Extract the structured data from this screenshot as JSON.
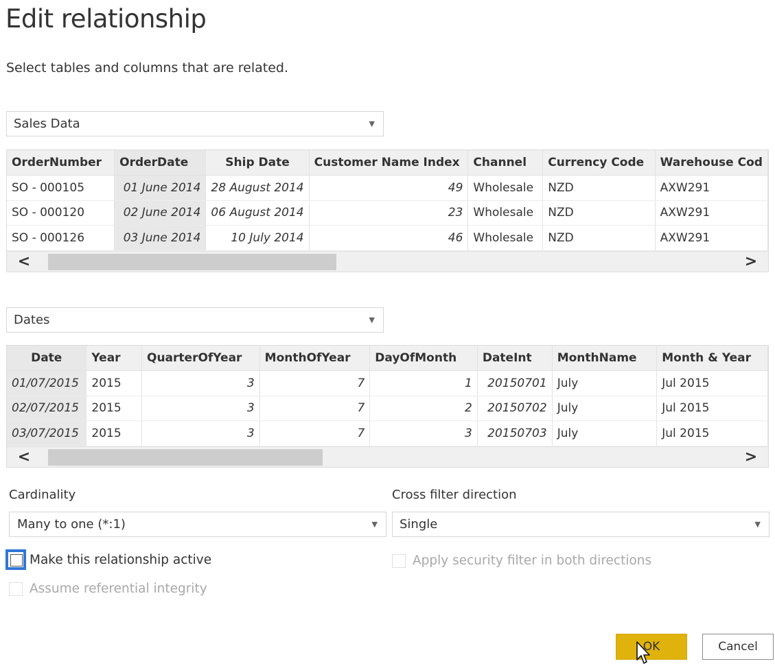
{
  "dialog": {
    "title": "Edit relationship",
    "subtitle": "Select tables and columns that are related."
  },
  "table1": {
    "selected_table": "Sales Data",
    "columns": [
      "OrderNumber",
      "OrderDate",
      "Ship Date",
      "Customer Name Index",
      "Channel",
      "Currency Code",
      "Warehouse Cod"
    ],
    "rows": [
      [
        "SO - 000105",
        "01 June 2014",
        "28 August 2014",
        "49",
        "Wholesale",
        "NZD",
        "AXW291"
      ],
      [
        "SO - 000120",
        "02 June 2014",
        "06 August 2014",
        "23",
        "Wholesale",
        "NZD",
        "AXW291"
      ],
      [
        "SO - 000126",
        "03 June 2014",
        "10 July 2014",
        "46",
        "Wholesale",
        "NZD",
        "AXW291"
      ]
    ]
  },
  "table2": {
    "selected_table": "Dates",
    "columns": [
      "Date",
      "Year",
      "QuarterOfYear",
      "MonthOfYear",
      "DayOfMonth",
      "DateInt",
      "MonthName",
      "Month & Year"
    ],
    "rows": [
      [
        "01/07/2015",
        "2015",
        "3",
        "7",
        "1",
        "20150701",
        "July",
        "Jul 2015"
      ],
      [
        "02/07/2015",
        "2015",
        "3",
        "7",
        "2",
        "20150702",
        "July",
        "Jul 2015"
      ],
      [
        "03/07/2015",
        "2015",
        "3",
        "7",
        "3",
        "20150703",
        "July",
        "Jul 2015"
      ]
    ]
  },
  "options": {
    "cardinality_label": "Cardinality",
    "cardinality_value": "Many to one (*:1)",
    "cross_filter_label": "Cross filter direction",
    "cross_filter_value": "Single",
    "make_active_label": "Make this relationship active",
    "make_active_checked": false,
    "security_filter_label": "Apply security filter in both directions",
    "security_filter_checked": false,
    "referential_integrity_label": "Assume referential integrity",
    "referential_integrity_checked": false
  },
  "buttons": {
    "ok": "OK",
    "cancel": "Cancel"
  },
  "colors": {
    "ok_button": "#e0b20c",
    "focus_ring": "#2f77d6"
  }
}
